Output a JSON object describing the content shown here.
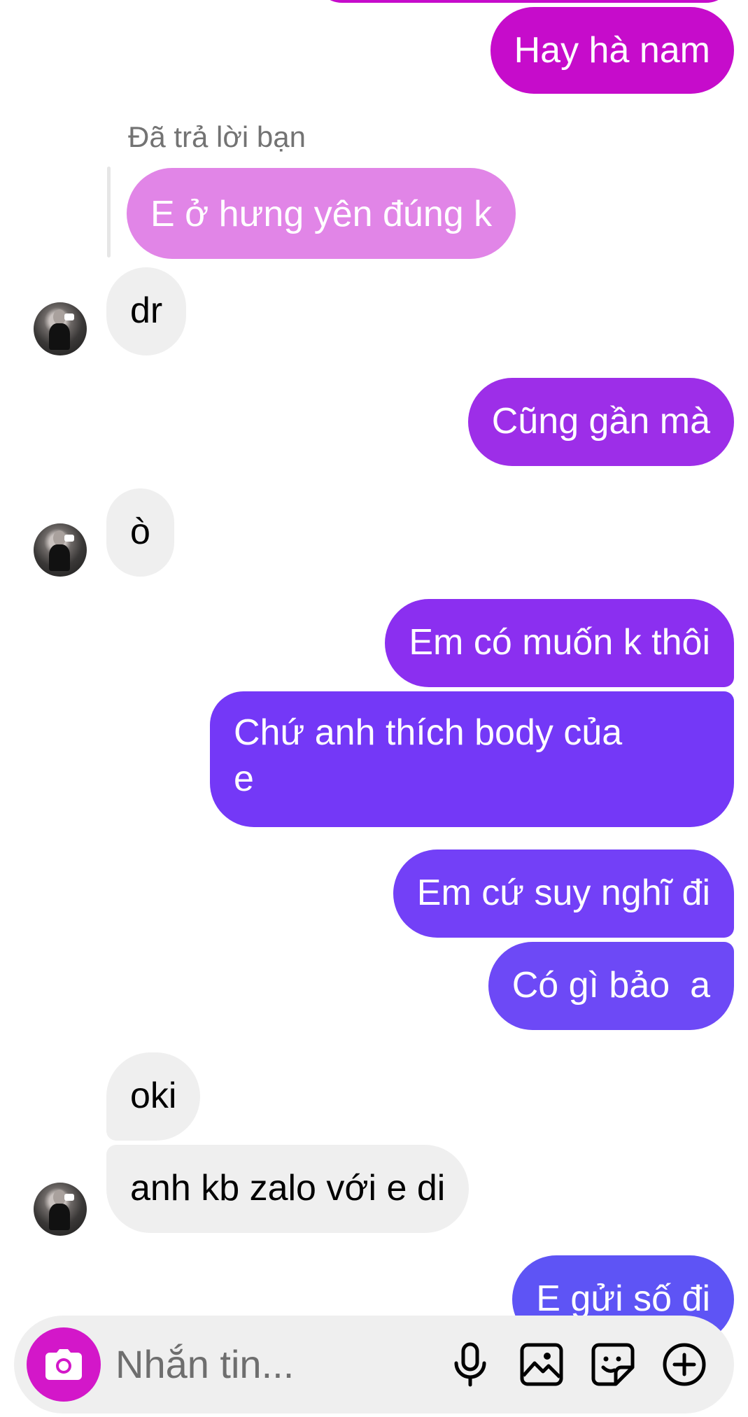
{
  "thread": {
    "reply_label": "Đã trả lời bạn",
    "messages": [
      {
        "id": "m1",
        "direction": "out",
        "text": "Hay hà nam",
        "color": "#c60ccb"
      },
      {
        "id": "m2",
        "direction": "quoted",
        "text": "E ở hưng yên đúng k",
        "color": "#e185e7"
      },
      {
        "id": "m3",
        "direction": "in",
        "text": "dr"
      },
      {
        "id": "m4",
        "direction": "out",
        "text": "Cũng gần mà",
        "color": "#9d2ee8"
      },
      {
        "id": "m5",
        "direction": "in",
        "text": "ò"
      },
      {
        "id": "m6",
        "direction": "out",
        "text": "Em có muốn k thôi",
        "color": "#8b2ff0"
      },
      {
        "id": "m7",
        "direction": "out",
        "text_line1": "Chứ anh thích body của",
        "text_line2": "e",
        "color": "#7438f7"
      },
      {
        "id": "m8",
        "direction": "out",
        "text": "Em cứ suy nghĩ đi",
        "color": "#7340f7"
      },
      {
        "id": "m9",
        "direction": "out",
        "text": "Có gì bảo  a",
        "color": "#6d49f6"
      },
      {
        "id": "m10",
        "direction": "in",
        "text": "oki"
      },
      {
        "id": "m11",
        "direction": "in",
        "text": "anh kb zalo với e di"
      },
      {
        "id": "m12",
        "direction": "out",
        "text": "E gửi số đi",
        "color": "#5e54f5"
      }
    ]
  },
  "composer": {
    "placeholder": "Nhắn tin...",
    "camera_button_color": "#d317c9",
    "icons": [
      "camera-icon",
      "microphone-icon",
      "image-icon",
      "sticker-icon",
      "plus-circle-icon"
    ]
  }
}
